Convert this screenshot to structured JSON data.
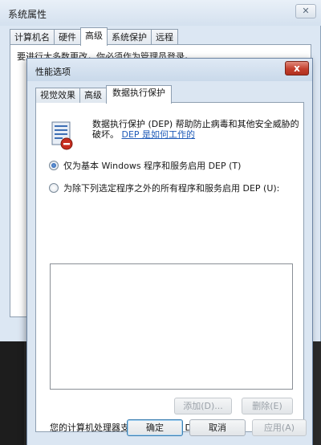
{
  "background_window": {
    "title": "系统属性",
    "tabs": [
      "计算机名",
      "硬件",
      "高级",
      "系统保护",
      "远程"
    ],
    "active_tab": "高级",
    "partial_text": "要进行大多数更改，你必须作为管理员登录。"
  },
  "dialog": {
    "title": "性能选项",
    "close_label": "x",
    "tabs": [
      "视觉效果",
      "高级",
      "数据执行保护"
    ],
    "active_tab": "数据执行保护",
    "description": "数据执行保护 (DEP) 帮助防止病毒和其他安全威胁的破坏。",
    "description_link": "DEP 是如何工作的",
    "options": [
      {
        "label": "仅为基本 Windows 程序和服务启用 DEP (T)",
        "selected": true
      },
      {
        "label": "为除下列选定程序之外的所有程序和服务启用 DEP (U):",
        "selected": false
      }
    ],
    "add_button": "添加(D)...",
    "remove_button": "删除(E)",
    "support_text": "您的计算机处理器支持基于硬件的 DEP。",
    "ok_button": "确定",
    "cancel_button": "取消",
    "apply_button": "应用(A)"
  },
  "icons": {
    "dep": "dep-shield-icon",
    "close": "close-icon"
  },
  "colors": {
    "window_bg": "#dbe6f2",
    "link": "#1f5bb8",
    "close_button": "#c4402e"
  }
}
